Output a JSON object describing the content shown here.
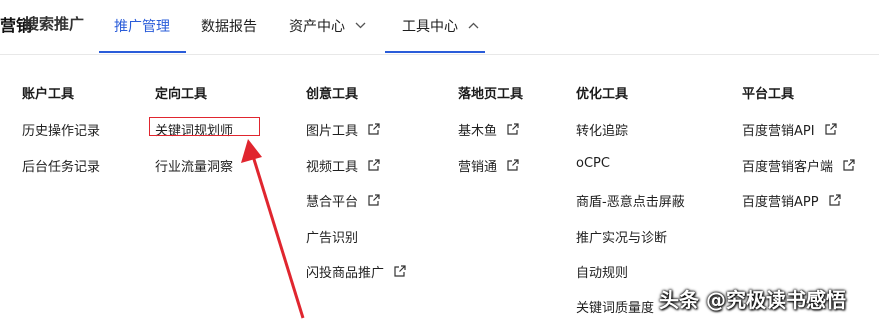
{
  "header": {
    "brand_partial": "营销",
    "brand_product": "搜索推广",
    "nav": [
      {
        "label": "推广管理"
      },
      {
        "label": "数据报告"
      },
      {
        "label": "资产中心"
      },
      {
        "label": "工具中心"
      }
    ]
  },
  "columns": [
    {
      "title": "账户工具",
      "items": [
        "历史操作记录",
        "后台任务记录"
      ]
    },
    {
      "title": "定向工具",
      "items": [
        "关键词规划师",
        "行业流量洞察"
      ]
    },
    {
      "title": "创意工具",
      "items": [
        "图片工具",
        "视频工具",
        "慧合平台",
        "广告识别",
        "闪投商品推广"
      ]
    },
    {
      "title": "落地页工具",
      "items": [
        "基木鱼",
        "营销通"
      ]
    },
    {
      "title": "优化工具",
      "items": [
        "转化追踪",
        "oCPC",
        "商盾-恶意点击屏蔽",
        "推广实况与诊断",
        "自动规则",
        "关键词质量度"
      ]
    },
    {
      "title": "平台工具",
      "items": [
        "百度营销API",
        "百度营销客户端",
        "百度营销APP"
      ]
    }
  ],
  "watermark": "头条 @究极读书感悟",
  "colors": {
    "accent": "#2a5cd9",
    "annotation": "#e0262f"
  },
  "icons": [
    "external-link-icon",
    "chevron-down-icon",
    "chevron-up-icon",
    "annotation-arrow"
  ]
}
